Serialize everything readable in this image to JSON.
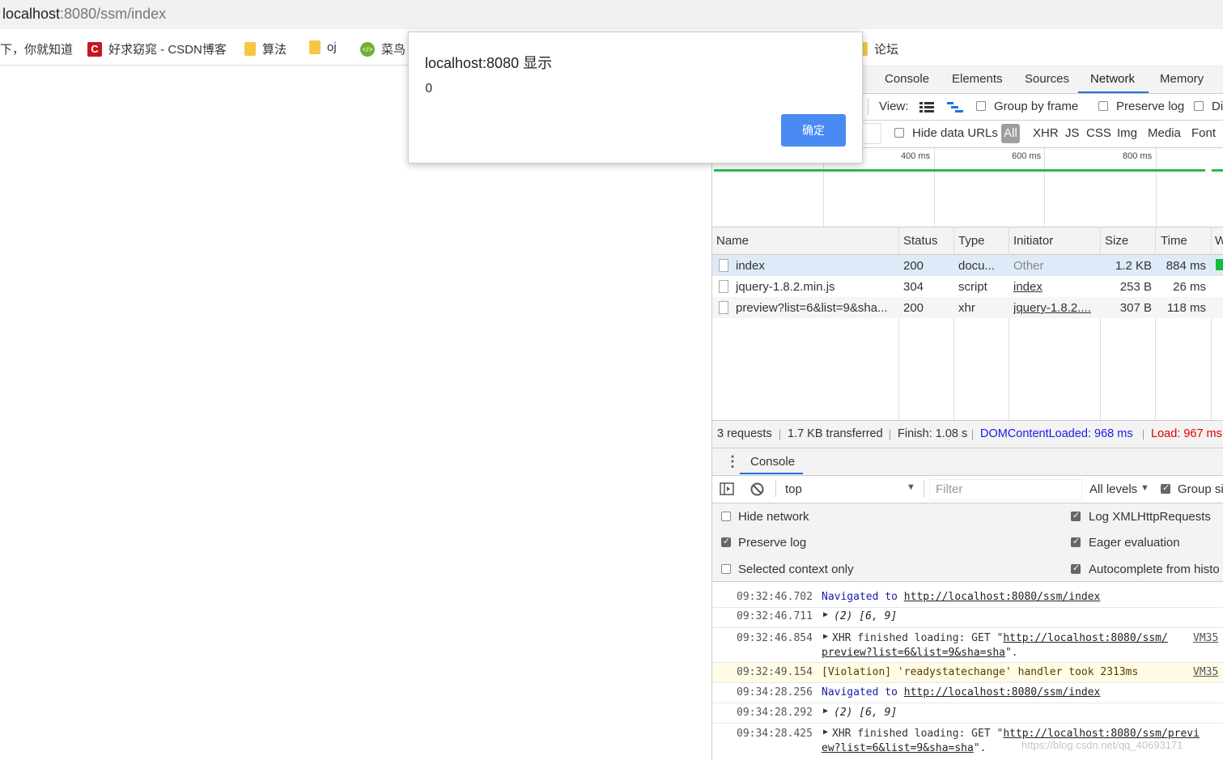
{
  "browser": {
    "url_host": "localhost",
    "url_rest": ":8080/ssm/index",
    "bookmarks": [
      {
        "label": "下，你就知道",
        "icon": "none"
      },
      {
        "label": "好求窈窕 - CSDN博客",
        "icon": "csdn-icon"
      },
      {
        "label": "算法",
        "icon": "folder-icon"
      },
      {
        "label": "oj",
        "icon": "folder-icon"
      },
      {
        "label": "菜鸟",
        "icon": "runoob-icon"
      },
      {
        "label": "论坛",
        "icon": "folder-icon"
      }
    ]
  },
  "dialog": {
    "title": "localhost:8080 显示",
    "message": "0",
    "ok_label": "确定"
  },
  "devtools": {
    "tabs": [
      "Console",
      "Elements",
      "Sources",
      "Network",
      "Memory"
    ],
    "active_tab": "Network",
    "toolbar": {
      "view_label": "View:",
      "group_by_frame": "Group by frame",
      "preserve_log": "Preserve log",
      "disable_cache": "Di"
    },
    "filter_bar": {
      "hide_data_urls": "Hide data URLs",
      "types": [
        "All",
        "XHR",
        "JS",
        "CSS",
        "Img",
        "Media",
        "Font"
      ]
    },
    "timeline_ticks": [
      "400 ms",
      "600 ms",
      "800 ms"
    ],
    "table": {
      "columns": [
        "Name",
        "Status",
        "Type",
        "Initiator",
        "Size",
        "Time",
        "W"
      ],
      "rows": [
        {
          "name": "index",
          "status": "200",
          "type": "docu...",
          "initiator": "Other",
          "size": "1.2 KB",
          "time": "884 ms"
        },
        {
          "name": "jquery-1.8.2.min.js",
          "status": "304",
          "type": "script",
          "initiator": "index",
          "size": "253 B",
          "time": "26 ms"
        },
        {
          "name": "preview?list=6&list=9&sha...",
          "status": "200",
          "type": "xhr",
          "initiator": "jquery-1.8.2....",
          "size": "307 B",
          "time": "118 ms"
        }
      ]
    },
    "summary": {
      "requests": "3 requests",
      "transferred": "1.7 KB transferred",
      "finish": "Finish: 1.08 s",
      "dcl": "DOMContentLoaded: 968 ms",
      "load": "Load: 967 ms"
    },
    "drawer": {
      "tab": "Console",
      "context": "top",
      "filter_placeholder": "Filter",
      "levels": "All levels",
      "group_similar": "Group si",
      "settings": {
        "hide_network": "Hide network",
        "preserve_log": "Preserve log",
        "selected_context": "Selected context only",
        "log_xhr": "Log XMLHttpRequests",
        "eager_eval": "Eager evaluation",
        "autocomplete": "Autocomplete from histo"
      }
    },
    "console_logs": [
      {
        "time": "09:32:46.702",
        "kind": "nav",
        "text": "Navigated to",
        "url": "http://localhost:8080/ssm/index"
      },
      {
        "time": "09:32:46.711",
        "kind": "arr",
        "text": "(2) [6, 9]"
      },
      {
        "time": "09:32:46.854",
        "kind": "xhr",
        "text": "XHR finished loading: GET \"",
        "url1": "http://localhost:8080/ssm/",
        "url2": "preview?list=6&list=9&sha=sha",
        "tail": "\".",
        "source": "VM35"
      },
      {
        "time": "09:32:49.154",
        "kind": "violation",
        "text": "[Violation] 'readystatechange' handler took 2313ms",
        "source": "VM35"
      },
      {
        "time": "09:34:28.256",
        "kind": "nav",
        "text": "Navigated to",
        "url": "http://localhost:8080/ssm/index"
      },
      {
        "time": "09:34:28.292",
        "kind": "arr",
        "text": "(2) [6, 9]"
      },
      {
        "time": "09:34:28.425",
        "kind": "xhr",
        "text": "XHR finished loading: GET \"",
        "url1": "http://localhost:8080/ssm/previ",
        "url2": "ew?list=6&list=9&sha=sha",
        "tail": "\"."
      }
    ],
    "watermark": "https://blog.csdn.net/qq_40693171"
  }
}
